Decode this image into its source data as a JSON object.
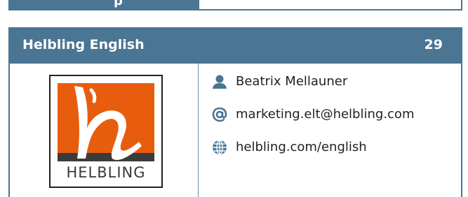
{
  "previous_card": {
    "visible_glyph": "p"
  },
  "card": {
    "title": "Helbling English",
    "number": "29",
    "logo": {
      "wordmark": "HELBLING",
      "colors": {
        "orange": "#e85d0d",
        "dark": "#3b3b3b",
        "white": "#ffffff"
      }
    },
    "contacts": [
      {
        "icon": "person-icon",
        "text": "Beatrix Mellauner"
      },
      {
        "icon": "at-icon",
        "text": "marketing.elt@helbling.com"
      },
      {
        "icon": "globe-icon",
        "text": "helbling.com/english"
      }
    ]
  },
  "colors": {
    "header_blue": "#4a7593",
    "text": "#231f20"
  }
}
